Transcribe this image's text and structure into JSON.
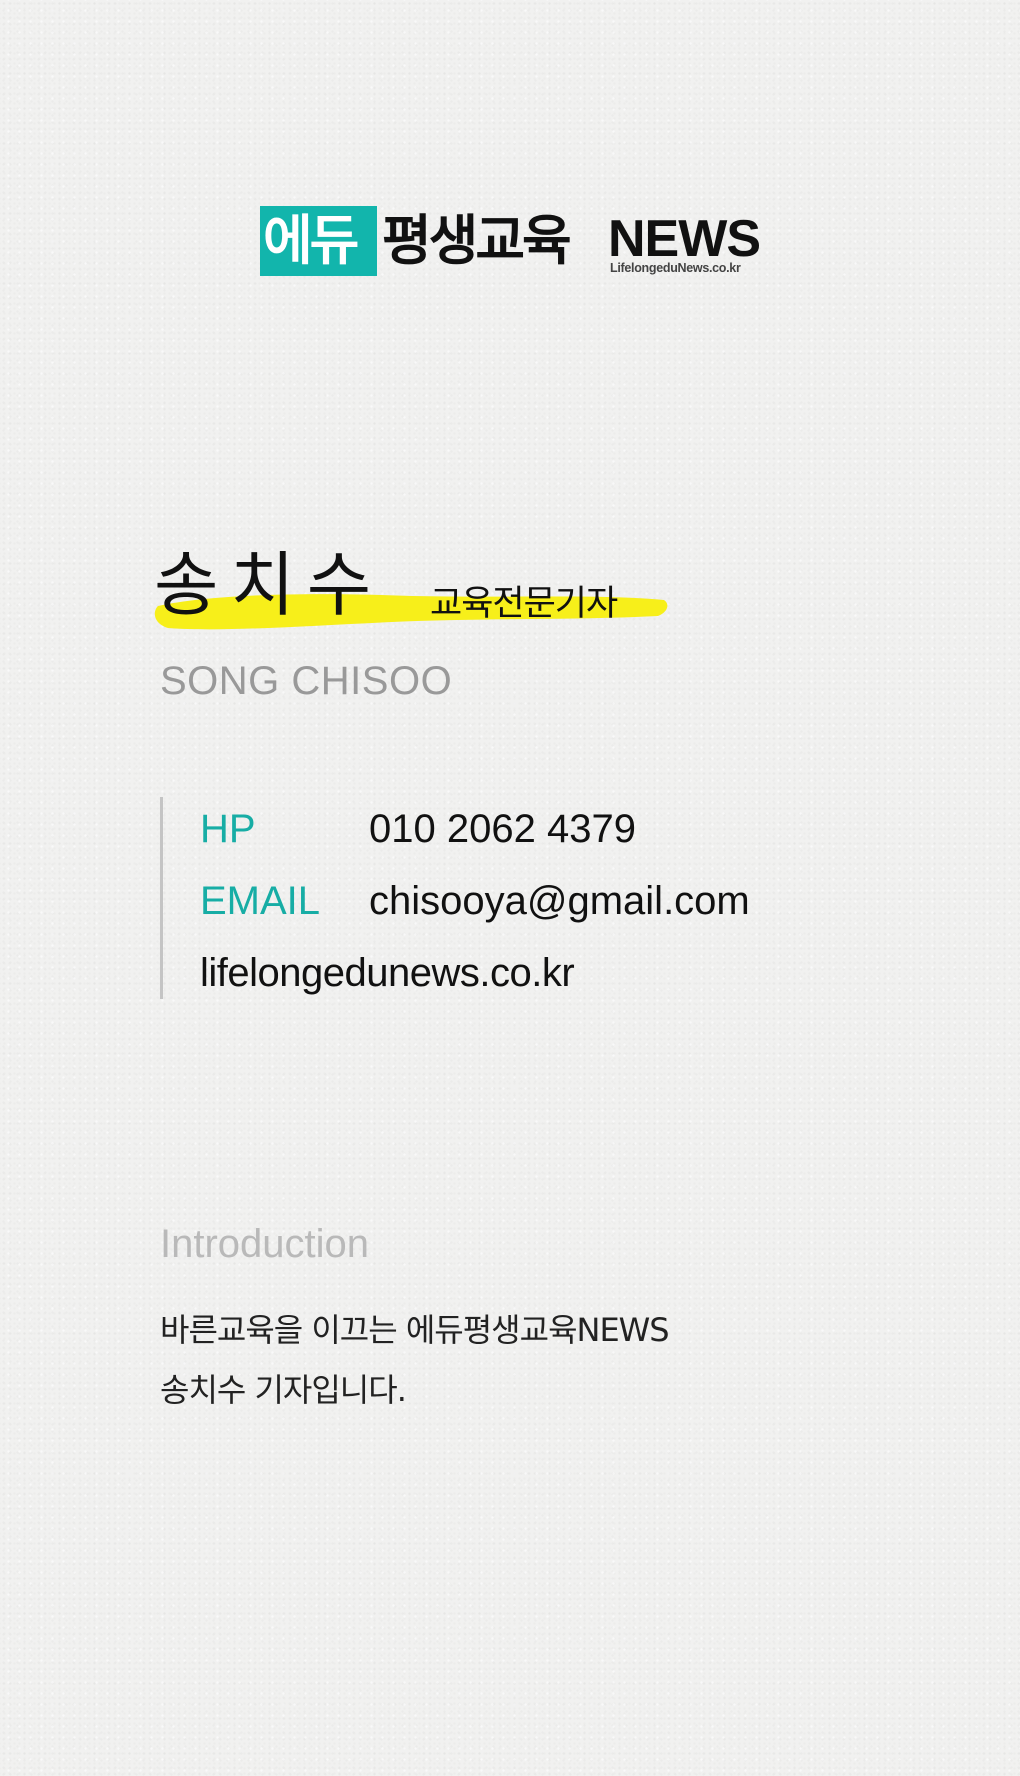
{
  "logo": {
    "badge_text": "에듀",
    "main_text": "평생교육",
    "news_text": "NEWS",
    "url_text": "LifelongeduNews.co.kr",
    "accent_color": "#12b5ac"
  },
  "profile": {
    "name": "송치수",
    "title": "교육전문기자",
    "name_en": "SONG CHISOO",
    "highlight_color": "#f7ef1a"
  },
  "contact": {
    "phone_label": "HP",
    "phone_value": "010 2062 4379",
    "email_label": "EMAIL",
    "email_value": "chisooya@gmail.com",
    "website": "lifelongedunews.co.kr",
    "label_color": "#17ada5"
  },
  "intro": {
    "heading": "Introduction",
    "line1": "바른교육을 이끄는 에듀평생교육NEWS",
    "line2": "송치수 기자입니다."
  }
}
